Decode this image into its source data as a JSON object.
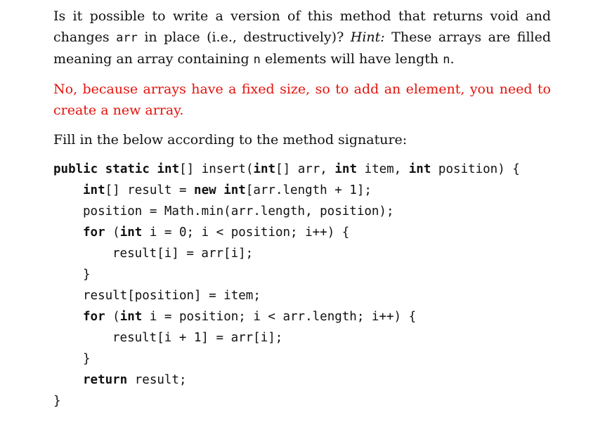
{
  "question": {
    "p1": "Is it possible to write a version of this method that returns void and changes",
    "arr": "arr",
    "p2": " in place (i.e., destructively)? ",
    "hint_label": "Hint:",
    "p3": " These arrays are filled meaning an array containing ",
    "n1": "n",
    "p4": " elements will have length ",
    "n2": "n",
    "p5": "."
  },
  "answer": "No, because arrays have a fixed size, so to add an element, you need to create a new array.",
  "instruction": "Fill in the below according to the method signature:",
  "code": {
    "sig_kw1": "public static int",
    "sig_t1": "[] insert(",
    "sig_kw2": "int",
    "sig_t2": "[] arr, ",
    "sig_kw3": "int",
    "sig_t3": " item, ",
    "sig_kw4": "int",
    "sig_t4": " position) {",
    "l1_kw1": "int",
    "l1_t1": "[] result = ",
    "l1_kw2": "new int",
    "l1_t2": "[arr.length + 1];",
    "l2": "position = Math.min(arr.length, position);",
    "l3_kw1": "for",
    "l3_t1": " (",
    "l3_kw2": "int",
    "l3_t2": " i = 0; i < position; i++) {",
    "l4": "result[i] = arr[i];",
    "l5": "}",
    "l6": "result[position] = item;",
    "l7_kw1": "for",
    "l7_t1": " (",
    "l7_kw2": "int",
    "l7_t2": " i = position; i < arr.length; i++) {",
    "l8": "result[i + 1] = arr[i];",
    "l9": "}",
    "l10_kw": "return",
    "l10_t": " result;",
    "close": "}"
  }
}
